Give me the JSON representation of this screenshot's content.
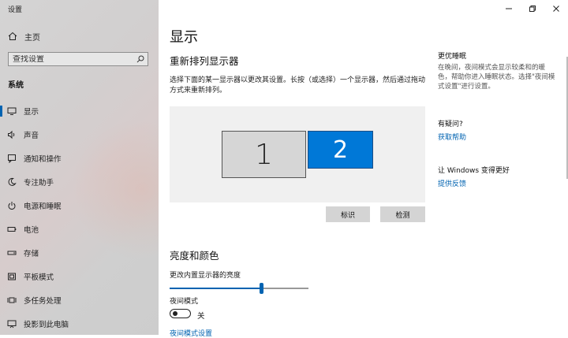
{
  "window": {
    "title": "设置"
  },
  "sidebar": {
    "home_label": "主页",
    "search_placeholder": "查找设置",
    "section_title": "系统",
    "items": [
      {
        "label": "显示",
        "icon": "monitor-icon",
        "active": true
      },
      {
        "label": "声音",
        "icon": "speaker-icon"
      },
      {
        "label": "通知和操作",
        "icon": "notification-icon"
      },
      {
        "label": "专注助手",
        "icon": "moon-icon"
      },
      {
        "label": "电源和睡眠",
        "icon": "power-icon"
      },
      {
        "label": "电池",
        "icon": "battery-icon"
      },
      {
        "label": "存储",
        "icon": "storage-icon"
      },
      {
        "label": "平板模式",
        "icon": "tablet-icon"
      },
      {
        "label": "多任务处理",
        "icon": "multitask-icon"
      },
      {
        "label": "投影到此电脑",
        "icon": "projector-icon"
      }
    ]
  },
  "main": {
    "page_title": "显示",
    "arrange": {
      "heading": "重新排列显示器",
      "description": "选择下面的某一显示器以更改其设置。长按（或选择）一个显示器，然后通过拖动方式来重新排列。",
      "monitor1_label": "1",
      "monitor2_label": "2",
      "identify_button": "标识",
      "detect_button": "检测"
    },
    "brightness": {
      "heading": "亮度和颜色",
      "slider_label": "更改内置显示器的亮度",
      "slider_value_percent": 66,
      "night_light_label": "夜间模式",
      "night_light_state": "关",
      "night_light_link": "夜间模式设置"
    }
  },
  "right_panel": {
    "sleep_heading": "更优睡眠",
    "sleep_text": "在晚间，夜间模式会显示较柔和的暖色，帮助你进入睡眠状态。选择\"夜间模式设置\"进行设置。",
    "help_heading": "有疑问?",
    "help_link": "获取帮助",
    "feedback_heading": "让 Windows 变得更好",
    "feedback_link": "提供反馈"
  },
  "colors": {
    "accent": "#0063b1",
    "primary_monitor": "#0078d7"
  }
}
